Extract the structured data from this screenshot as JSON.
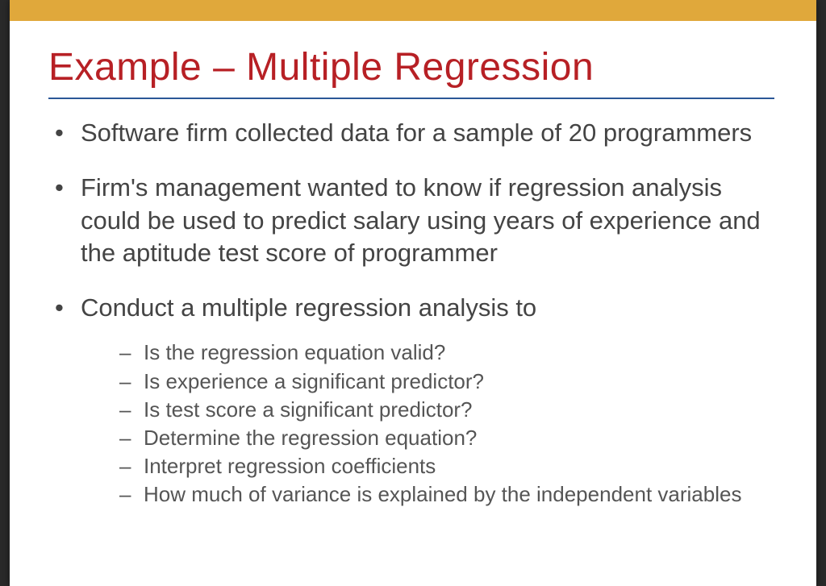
{
  "slide": {
    "title": "Example – Multiple Regression",
    "bullets": [
      {
        "text": "Software firm collected data for a sample of 20 programmers",
        "sub": []
      },
      {
        "text": "Firm's management wanted to know if regression analysis could be used to predict salary using years of experience and the aptitude test score of programmer",
        "sub": []
      },
      {
        "text": "Conduct a multiple regression analysis to",
        "sub": [
          "Is the regression equation valid?",
          "Is experience a significant predictor?",
          "Is test score a significant predictor?",
          "Determine the regression equation?",
          "Interpret regression coefficients",
          "How much of variance is explained by the independent variables"
        ]
      }
    ]
  }
}
